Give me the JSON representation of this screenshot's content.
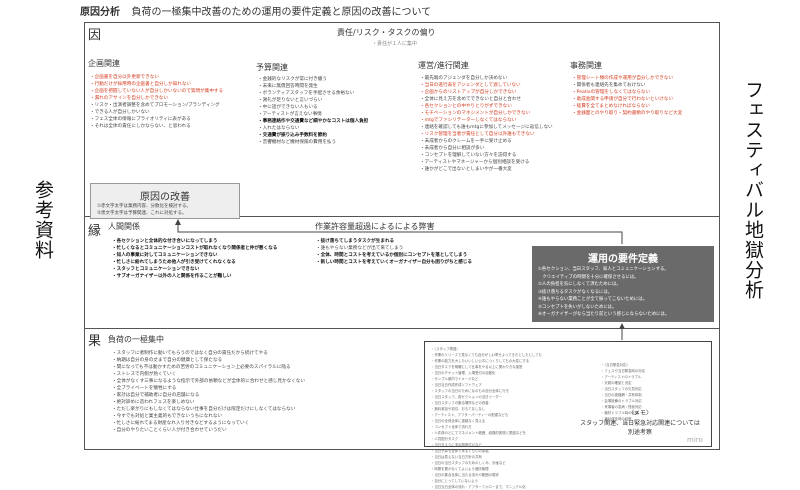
{
  "header": {
    "tag": "原因分析",
    "title": "負荷の一極集中改善のための運用の要件定義と原因の改善について"
  },
  "sidebar": {
    "left": "参考資料",
    "right": "フェスティバル地獄分析"
  },
  "sections": {
    "cause": {
      "label": "因",
      "center_title": "責任/リスク・タスクの偏り",
      "center_note": "・責任が１人に集中",
      "columns": [
        {
          "title": "企画関連",
          "items": [
            {
              "text": "企画書を自分以外更新できない",
              "style": "hl"
            },
            {
              "text": "行動だけが採用時の企画書と自分しか知れない",
              "style": "hl"
            },
            {
              "text": "企画を把握していない人が自分しかいないので質問が集中する",
              "style": "hl"
            },
            {
              "text": "漏れのアサインを自分しかできない",
              "style": "hl"
            },
            {
              "text": "リスク・出演者調整を含めてプロモーション/ブランディング",
              "style": "normal"
            },
            {
              "text": "できる人が自分しかいない",
              "style": "normal"
            },
            {
              "text": "フェス全体の情報にプライオリティに表がある",
              "style": "normal"
            },
            {
              "text": "それは全体の責任にしかならない、と思われる",
              "style": "normal"
            }
          ]
        },
        {
          "title": "予算関連",
          "items": [
            {
              "text": "金銭的なリスクが常に付き纏う",
              "style": "normal"
            },
            {
              "text": "未来に無償回答時間を発生",
              "style": "normal"
            },
            {
              "text": "ボランティアスタッフを手配させる余裕ない",
              "style": "normal"
            },
            {
              "text": "謝礼が足りないと言いづらい",
              "style": "normal"
            },
            {
              "text": "中に話ができない人もいる",
              "style": "normal"
            },
            {
              "text": "アーティストが言えない事情",
              "style": "normal"
            },
            {
              "text": "事務連絡作や交通費など細やかなコストは個人負担",
              "style": "bold"
            },
            {
              "text": "入れたはならない",
              "style": "normal"
            },
            {
              "text": "交通費が振り込み手数料を節約",
              "style": "bold"
            },
            {
              "text": "音響機材など機材保険の費用を払う",
              "style": "normal"
            }
          ]
        },
        {
          "title": "運営/進行関連",
          "items": [
            {
              "text": "最先端のアジェンダを自分しか決めない",
              "style": "normal"
            },
            {
              "text": "当日の進行表をアジェンダとして渡していない",
              "style": "hl"
            },
            {
              "text": "企画からのリストアップが自分しかできない",
              "style": "hl"
            },
            {
              "text": "全体に見え方を含めてできないと自分と合わせ",
              "style": "normal"
            },
            {
              "text": "各セクションとの中やりとりがずできない",
              "style": "hl"
            },
            {
              "text": "モチベーションのマネジメントが自分しかできない",
              "style": "hl"
            },
            {
              "text": "mtgでファシリテーターしなくてはならない",
              "style": "hl"
            },
            {
              "text": "連絡を確認しても誰もmtgに参加してメッセージに返信しない",
              "style": "normal"
            },
            {
              "text": "リスク管理を当者が責任として自分以外誰もできない",
              "style": "hl"
            },
            {
              "text": "未成者からのクレームを一手に受け止める",
              "style": "normal"
            },
            {
              "text": "未成者から自分に相談が多い",
              "style": "normal"
            },
            {
              "text": "コンセプトを理解していない方々を説得する",
              "style": "normal"
            },
            {
              "text": "アーティストやマネージャーから個別相談を受ける",
              "style": "normal"
            },
            {
              "text": "誰かがどこで出ないとしまいやが一番大変",
              "style": "normal"
            }
          ]
        },
        {
          "title": "事務関連",
          "items": [
            {
              "text": "管理シート類の作成や運用が自分しかできない",
              "style": "hl"
            },
            {
              "text": "関係者も連絡先を集めておけない",
              "style": "normal"
            },
            {
              "text": "Peatixの管理をしなくてはならない",
              "style": "hl"
            },
            {
              "text": "助成金関する申請が自分で行わないといけない",
              "style": "hl"
            },
            {
              "text": "経費を全てまとめなければならない",
              "style": "hl"
            },
            {
              "text": "金銭面とのやり取り・契約書類のやり取りなど大変",
              "style": "hl"
            }
          ]
        }
      ],
      "improve_box": {
        "title": "原因の改善",
        "notes": [
          "①赤文字太字は業務内容、分散化を検討する。",
          "②黒文字太字は予算関連、これに対処する。"
        ]
      }
    },
    "edge": {
      "label": "縁",
      "col1": {
        "title": "人間関係",
        "items": [
          {
            "text": "各セクションと全体的な付き合いになってしまう",
            "style": "bold"
          },
          {
            "text": "忙しくなるとコミュニケーションコストが取れなくなり関係者と仲が悪くなる",
            "style": "bold"
          },
          {
            "text": "知人の事業に対してコミュニケーションできない",
            "style": "bold"
          },
          {
            "text": "忙しさに紛れてしまうため他人が引き受けてくれなくなる",
            "style": "bold"
          },
          {
            "text": "スタッフとコミュニケーションできない",
            "style": "bold"
          },
          {
            "text": "サブオーガナイザー以外の人と関係を作ることが難しい",
            "style": "bold"
          }
        ]
      },
      "col2": {
        "title": "作業許容量超過によるによる弊害",
        "items": [
          {
            "text": "抜け落ちてしまうタスクが生まれる",
            "style": "bold"
          },
          {
            "text": "誰もやらない業務などが出て来てしまう",
            "style": "normal"
          },
          {
            "text": "全体、時間とコストを考えているか個別にコンセプトを落としてしまう",
            "style": "bold"
          },
          {
            "text": "新しい時間とコストを考えていくオーガナイザー自分も困りがちと感じる",
            "style": "bold"
          }
        ]
      },
      "requirements": {
        "title": "運用の要件定義",
        "items": [
          "①各セクション、当日スタッフ、知人とコミュニケーションする。",
          "　クリエイティブの時間を十分に確保させるには。",
          "②人の負担を気にしなくて済むためには。",
          "③抜け落ちるタスクがなくなるには。",
          "④誰もやらない業務ことが全て振ってこないためには。",
          "⑤コンセプトを失いがしないためには。",
          "⑥オーガナイザーがなら当たり前という感じにならないためには。"
        ]
      }
    },
    "result": {
      "label": "果",
      "title": "負荷の一極集中",
      "items": [
        "スタッフに者制作に動いてもらうのではなく自分の責任だから続けてやる",
        "納期は自分の身の丈まで自分の健康として保たなる",
        "間になっても不は動かすための苦労のコミュニケーション上必要のスパイラルに陥る",
        "ストレスで内側が熱くていく",
        "全体がなくす三事になるような指示で外部の依頼などが全体的に合わせと感じ見かなくない",
        "全ブライベートを犠牲にする",
        "家計は自分で補助者に自分の店舗になる",
        "絶対諦めに造われフェスを楽しめない",
        "ただし楽がりにもしなくてはならない仕事を自分だけは限定だけにしなくてはならない",
        "今すでも対処と業主義的もできないうちになれない",
        "忙しさに紛れてまる財産なれ入り付きなどするようになっていく",
        "自分のやりたいことくらい人が付き合わせていうだい"
      ]
    }
  },
  "notes_box": {
    "memo_title": "〈メモ〉",
    "memo_line1": "スタッフ関連、当日緊急対応関連については",
    "memo_line2": "別途考察",
    "watermark": "miro",
    "left_items": [
      "〈スタッフ関連〉",
      "作業のリリースで見なくても自分がしわ寄せよってきたとしたとしても",
      "作業の能力を大したいいしい公平につくりしてもの大変にする",
      "当日タスクを明確にして仕事をやる以上に関わりきな運営",
      "当日のチケット管理、入場受付の自動化",
      "サンプル案内でイメージなど",
      "当日当日作成作成ソフトウェア",
      "スタッフの当日のためになのもの自分全体に行き",
      "当日スタッフ、各セクションの当日リーダー",
      "当日スタッフの集合場所などの改善",
      "無料参加や割引、おもてなしなし",
      "アーティスト、アフターパーティーの配慮なども",
      "当日の全体全体に連絡なく見える",
      "コンセプト全体で流れ方",
      "人件費のどにてマネジメント範囲、経路的実態と関連などを",
      "人員配分タスク",
      "当日タスクに流れ関連付けなど",
      "当日予算も全体で来るくらいの余裕",
      "当日は見えない当日方針の共有",
      "当日の当日スタッフのためのしくみ、計画など",
      "時間を置かなくてよいよう進捗管理",
      "当日の集合全体に当たる流れや範囲の現状",
      "自分にとってしていないよう",
      "当日当日全体の流れ・アフターフォローまで、マニュアル化"
    ],
    "right_items": [
      "〈当日緊急対応〉",
      "フェスや当日緊急時の対応",
      "アーティストのトラブル",
      "天候の確認と決定",
      "当日スタッフの欠員対応",
      "当日の連絡網・共有体制",
      "会場設備のトラブル対応",
      "来場者の急病・怪我対応",
      "機材トラブル時の代替",
      "進行遅延時の判断"
    ]
  }
}
